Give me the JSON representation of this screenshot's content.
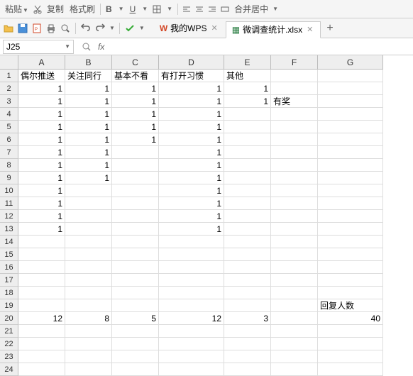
{
  "toolbar1": {
    "paste": "粘贴",
    "copy": "复制",
    "format_painter": "格式刷",
    "merge": "合并居中"
  },
  "tabs": {
    "wps": "我的WPS",
    "file": "微调查统计.xlsx"
  },
  "namebox": "J25",
  "fx": "fx",
  "columns": [
    "A",
    "B",
    "C",
    "D",
    "E",
    "F",
    "G"
  ],
  "headers": {
    "A": "偶尔推送",
    "B": "关注同行",
    "C": "基本不看",
    "D": "有打开习惯",
    "E": "其他",
    "F": "",
    "G": ""
  },
  "cells": {
    "2": {
      "A": "1",
      "B": "1",
      "C": "1",
      "D": "1",
      "E": "1"
    },
    "3": {
      "A": "1",
      "B": "1",
      "C": "1",
      "D": "1",
      "E": "1",
      "F": "有奖"
    },
    "4": {
      "A": "1",
      "B": "1",
      "C": "1",
      "D": "1"
    },
    "5": {
      "A": "1",
      "B": "1",
      "C": "1",
      "D": "1"
    },
    "6": {
      "A": "1",
      "B": "1",
      "C": "1",
      "D": "1"
    },
    "7": {
      "A": "1",
      "B": "1",
      "D": "1"
    },
    "8": {
      "A": "1",
      "B": "1",
      "D": "1"
    },
    "9": {
      "A": "1",
      "B": "1",
      "D": "1"
    },
    "10": {
      "A": "1",
      "D": "1"
    },
    "11": {
      "A": "1",
      "D": "1"
    },
    "12": {
      "A": "1",
      "D": "1"
    },
    "13": {
      "A": "1",
      "D": "1"
    },
    "19": {
      "G": "回复人数"
    },
    "20": {
      "A": "12",
      "B": "8",
      "C": "5",
      "D": "12",
      "E": "3",
      "G": "40"
    }
  },
  "rowCount": 24
}
